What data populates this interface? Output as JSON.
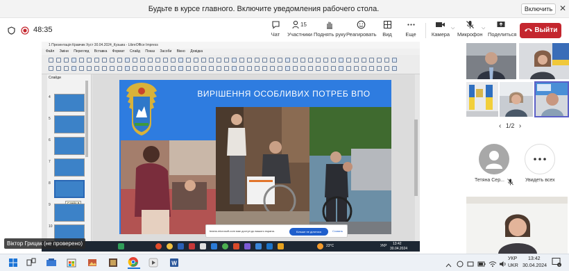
{
  "banner": {
    "text": "Будьте в курсе главного. Включите уведомления рабочего стола.",
    "enable_button": "Включить",
    "close_glyph": "✕"
  },
  "toolbar": {
    "timer": "48:35",
    "chat": "Чат",
    "participants": "Участники",
    "participants_count": "15",
    "raise_hand": "Поднять руку",
    "react": "Реагировать",
    "view": "Вид",
    "more": "Еще",
    "camera": "Камера",
    "mic": "Микрофон",
    "share": "Поделиться",
    "leave": "Выйти"
  },
  "presentation": {
    "window_title": "1 Презентація Кравчик Хуст 30.04.2024_Кузьма - LibreOffice Impress",
    "menu": [
      "Файл",
      "Зміни",
      "Перегляд",
      "Вставка",
      "Формат",
      "Слайд",
      "Показ",
      "Засоби",
      "Вікно",
      "Довідка"
    ],
    "side_title": "Слайди",
    "slide_numbers": [
      "4",
      "5",
      "6",
      "7",
      "8",
      "9",
      "10"
    ],
    "thumb_tooltip": "Слайд 9",
    "slide_title": "ВИРІШЕННЯ ОСОБЛИВИХ ПОТРЕБ ВПО",
    "tip_text": "teams.microsoft.com має доступ до вашого екрана.",
    "tip_button": "Більше не ділитися",
    "tip_link": "Сховать",
    "inner_temp": "23°C",
    "inner_lang": "УКР",
    "inner_time": "13:42",
    "inner_date": "30.04.2024"
  },
  "presenter_name": "Віктор Грицак (не проверено)",
  "participants_panel": {
    "pager": "1/2",
    "tile_name_1": "Тетяна Сер...",
    "see_all": "Увидеть всех"
  },
  "taskbar": {
    "temp": "",
    "lang_top": "УКР",
    "lang_bottom": "UKR",
    "time": "13:42",
    "date": "30.04.2024",
    "notif_count": "3"
  },
  "colors": {
    "leave_red": "#c4262e",
    "slide_blue": "#2e7ce0",
    "teams_accent": "#1f5fcc"
  }
}
